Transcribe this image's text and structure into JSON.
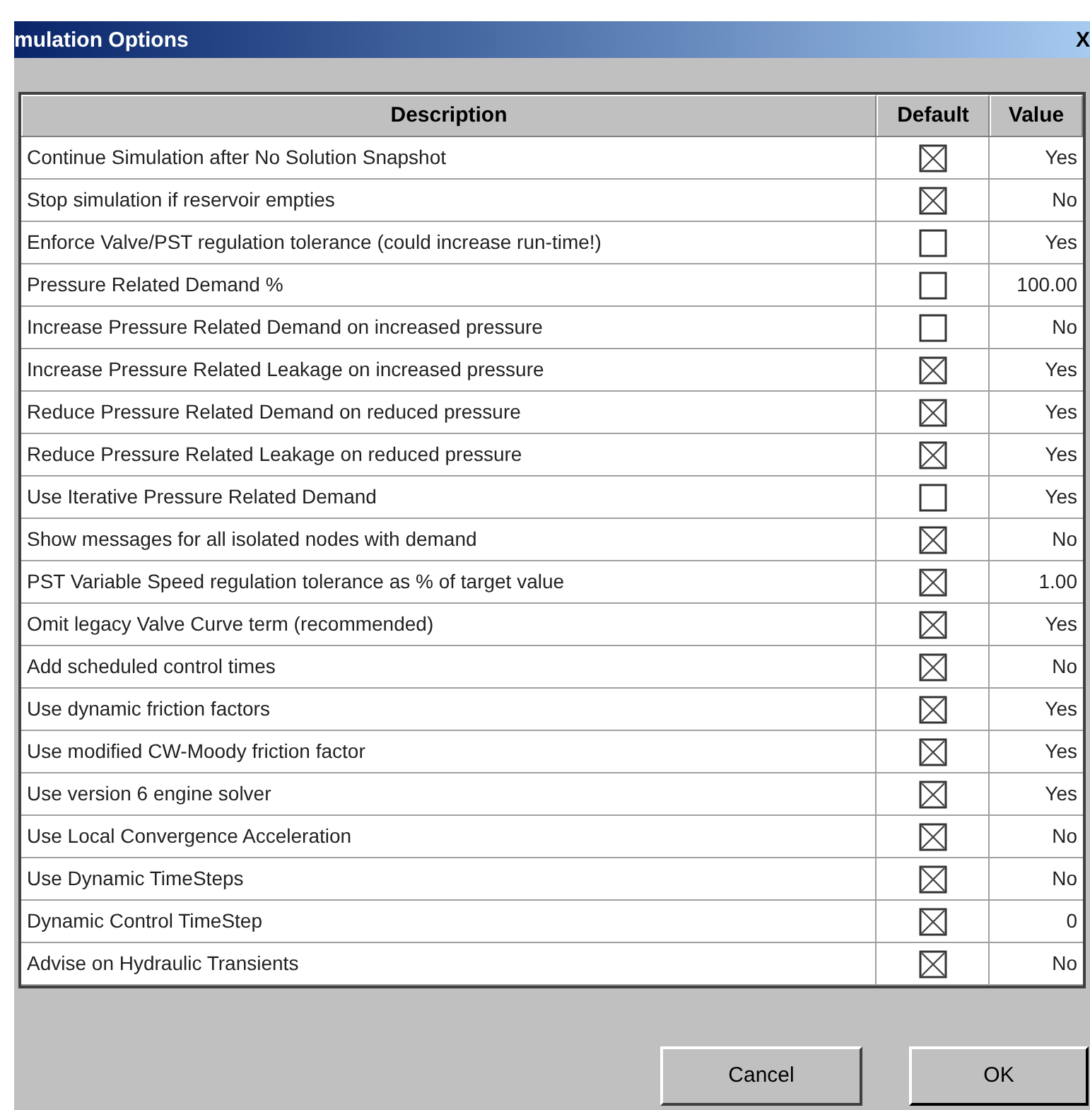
{
  "window": {
    "title": "mulation Options",
    "close_glyph": "X"
  },
  "table": {
    "columns": [
      "Description",
      "Default",
      "Value"
    ],
    "rows": [
      {
        "description": "Continue Simulation after No Solution Snapshot",
        "checked": true,
        "value": "Yes"
      },
      {
        "description": "Stop simulation if reservoir empties",
        "checked": true,
        "value": "No"
      },
      {
        "description": "Enforce Valve/PST regulation tolerance (could increase run-time!)",
        "checked": false,
        "value": "Yes"
      },
      {
        "description": "Pressure Related Demand %",
        "checked": false,
        "value": "100.00"
      },
      {
        "description": "Increase Pressure Related Demand on increased pressure",
        "checked": false,
        "value": "No"
      },
      {
        "description": "Increase Pressure Related Leakage on increased pressure",
        "checked": true,
        "value": "Yes"
      },
      {
        "description": "Reduce Pressure Related Demand on reduced pressure",
        "checked": true,
        "value": "Yes"
      },
      {
        "description": "Reduce Pressure Related Leakage on reduced pressure",
        "checked": true,
        "value": "Yes"
      },
      {
        "description": "Use Iterative Pressure Related Demand",
        "checked": false,
        "value": "Yes"
      },
      {
        "description": "Show messages for all isolated nodes with demand",
        "checked": true,
        "value": "No"
      },
      {
        "description": "PST Variable Speed regulation tolerance as % of target value",
        "checked": true,
        "value": "1.00"
      },
      {
        "description": "Omit legacy Valve Curve term (recommended)",
        "checked": true,
        "value": "Yes"
      },
      {
        "description": "Add scheduled control times",
        "checked": true,
        "value": "No"
      },
      {
        "description": "Use dynamic friction factors",
        "checked": true,
        "value": "Yes"
      },
      {
        "description": "Use modified CW-Moody friction factor",
        "checked": true,
        "value": "Yes"
      },
      {
        "description": "Use version 6 engine solver",
        "checked": true,
        "value": "Yes"
      },
      {
        "description": "Use Local Convergence Acceleration",
        "checked": true,
        "value": "No"
      },
      {
        "description": "Use Dynamic TimeSteps",
        "checked": true,
        "value": "No"
      },
      {
        "description": "Dynamic Control TimeStep",
        "checked": true,
        "value": "0"
      },
      {
        "description": "Advise on Hydraulic Transients",
        "checked": true,
        "value": "No"
      }
    ]
  },
  "buttons": [
    "Cancel",
    "OK"
  ]
}
